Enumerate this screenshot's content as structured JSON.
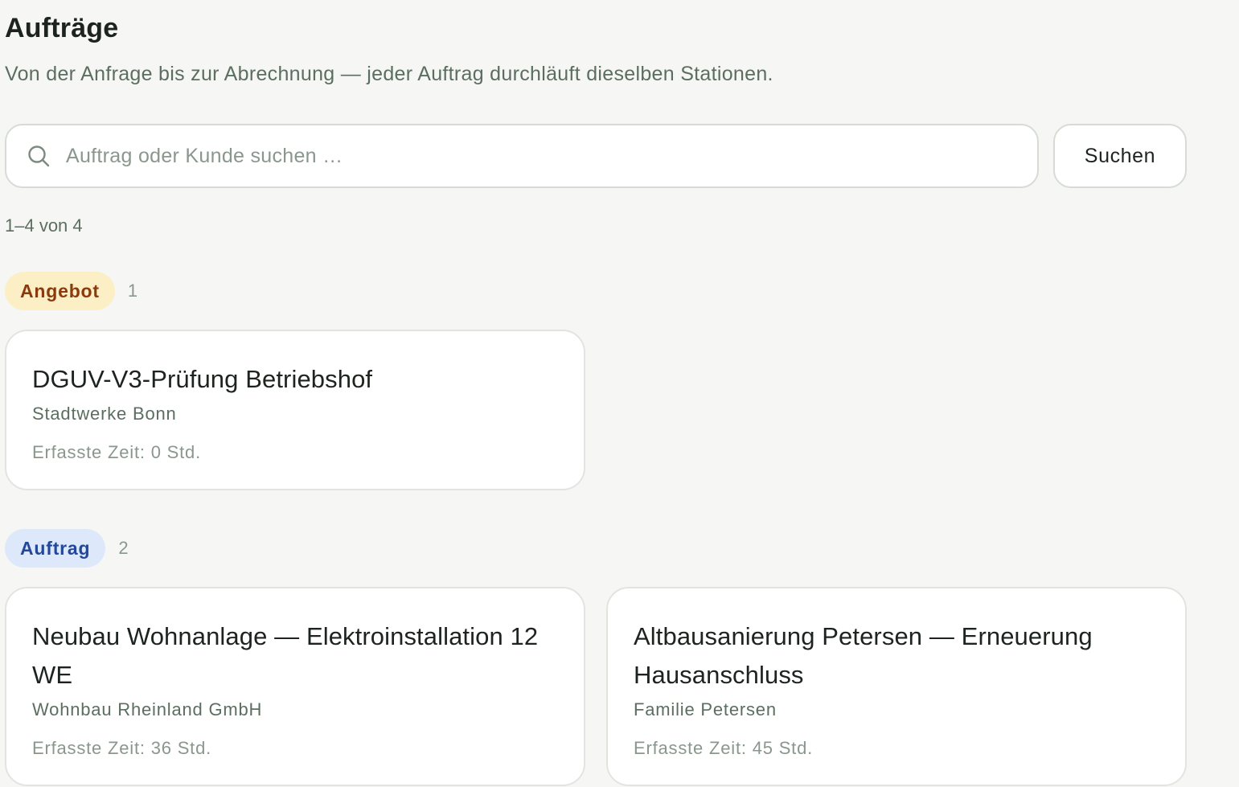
{
  "header": {
    "title": "Aufträge",
    "subtitle": "Von der Anfrage bis zur Abrechnung — jeder Auftrag durchläuft dieselben Stationen."
  },
  "search": {
    "placeholder": "Auftrag oder Kunde suchen …",
    "value": "",
    "button_label": "Suchen",
    "icon": "search-icon"
  },
  "results": {
    "count_label": "1–4 von 4"
  },
  "groups": [
    {
      "status": "Angebot",
      "count": "1",
      "color_bg": "#fdefc5",
      "color_text": "#8a3a0c",
      "orders": [
        {
          "title": "DGUV-V3-Prüfung Betriebshof",
          "customer": "Stadtwerke Bonn",
          "time_label": "Erfasste Zeit: 0 Std."
        }
      ]
    },
    {
      "status": "Auftrag",
      "count": "2",
      "color_bg": "#dde8fb",
      "color_text": "#23479a",
      "orders": [
        {
          "title": "Neubau Wohnanlage — Elektroinstallation 12 WE",
          "customer": "Wohnbau Rheinland GmbH",
          "time_label": "Erfasste Zeit: 36 Std."
        },
        {
          "title": "Altbausanierung Petersen — Erneuerung Hausanschluss",
          "customer": "Familie Petersen",
          "time_label": "Erfasste Zeit: 45 Std."
        }
      ]
    }
  ]
}
